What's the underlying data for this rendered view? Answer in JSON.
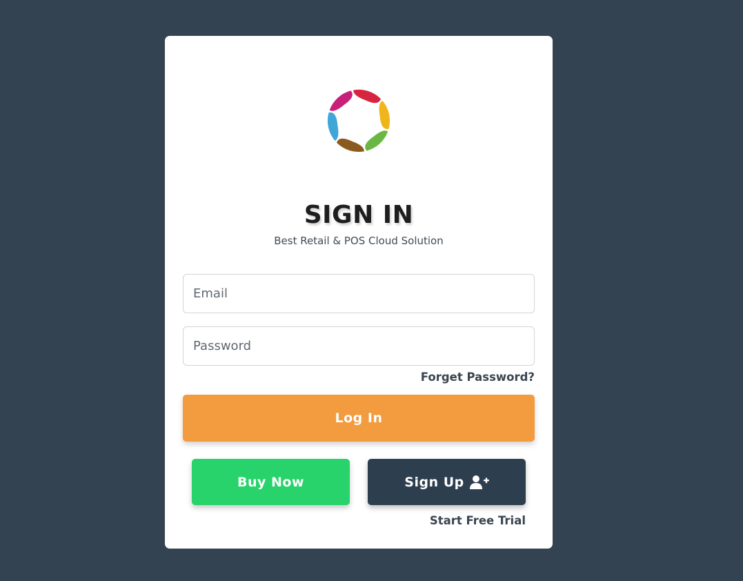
{
  "title": "SIGN IN",
  "subtitle": "Best Retail & POS Cloud Solution",
  "form": {
    "email_placeholder": "Email",
    "email_value": "",
    "password_placeholder": "Password",
    "password_value": "",
    "forgot_label": "Forget Password?",
    "login_label": "Log In"
  },
  "actions": {
    "buy_label": "Buy Now",
    "signup_label": "Sign Up",
    "signup_icon": "user-plus-icon",
    "trial_label": "Start Free Trial"
  },
  "colors": {
    "background": "#334352",
    "login_button": "#f39b3f",
    "buy_button": "#27d36a",
    "signup_button": "#2d3e4f"
  },
  "logo": {
    "icon": "logo-ring-icon",
    "segment_colors": [
      "#d6263f",
      "#f1b51c",
      "#6ab843",
      "#8b5a1e",
      "#3fa6d7",
      "#c8207a"
    ]
  }
}
